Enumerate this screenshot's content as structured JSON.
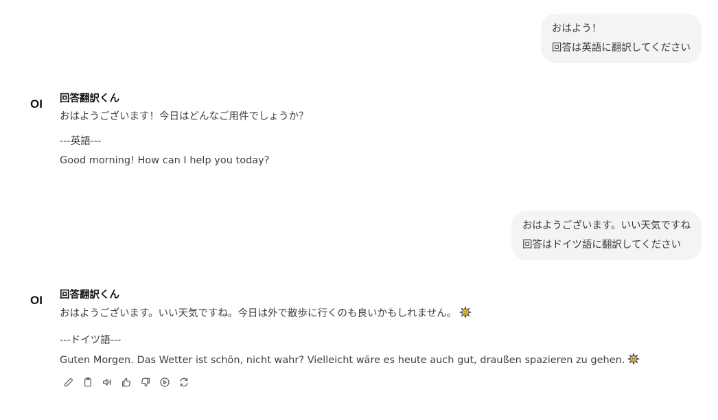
{
  "conversation": {
    "user_messages": [
      {
        "lines": [
          "おはよう！",
          "回答は英語に翻訳してください"
        ]
      },
      {
        "lines": [
          "おはようございます。いい天気ですね",
          "回答はドイツ語に翻訳してください"
        ]
      }
    ],
    "assistant_messages": [
      {
        "avatar_text": "OI",
        "name": "回答翻訳くん",
        "reply": "おはようございます！今日はどんなご用件でしょうか？",
        "separator": "---英語---",
        "translation": "Good morning! How can I help you today?"
      },
      {
        "avatar_text": "OI",
        "name": "回答翻訳くん",
        "reply": "おはようございます。いい天気ですね。今日は外で散歩に行くのも良いかもしれません。",
        "separator": "---ドイツ語---",
        "translation": "Guten Morgen. Das Wetter ist schön, nicht wahr? Vielleicht wäre es heute auch gut, draußen spazieren zu gehen."
      }
    ]
  },
  "icons": {
    "sun_emoji": "sun-emoji-icon",
    "toolbar": [
      "edit-icon",
      "copy-icon",
      "read-aloud-icon",
      "thumbs-up-icon",
      "thumbs-down-icon",
      "continue-icon",
      "regenerate-icon"
    ]
  },
  "colors": {
    "user_bubble_bg": "#f4f4f5",
    "text": "#3f3f3f",
    "name": "#111111",
    "sun": "#f4c430"
  }
}
